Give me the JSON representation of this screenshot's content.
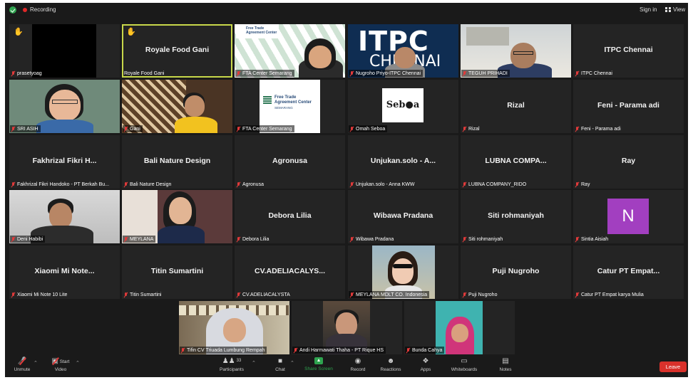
{
  "topbar": {
    "recording_label": "Recording",
    "signin_label": "Sign in",
    "view_label": "View"
  },
  "tiles": [
    {
      "name": "prasetyoag",
      "label": "prasetyoag",
      "center": "",
      "hand": true,
      "type": "black"
    },
    {
      "name": "Royale Food Gani",
      "label": "Royale Food Gani",
      "center": "Royale Food Gani",
      "hand": true,
      "type": "name-active"
    },
    {
      "name": "FTA Center Semarang 1",
      "label": "FTA Center Semarang",
      "center": "",
      "type": "fta-woman"
    },
    {
      "name": "Nugroho Priyo-ITPC Chennai",
      "label": "Nugroho Priyo-ITPC Chennai",
      "center": "",
      "type": "itpc"
    },
    {
      "name": "TEGUH PRIHADI",
      "label": "TEGUH PRIHADI",
      "center": "",
      "type": "man-glasses"
    },
    {
      "name": "ITPC Chennai",
      "label": "ITPC Chennai",
      "center": "ITPC Chennai",
      "type": "name"
    },
    {
      "name": "SRI ASIH",
      "label": "SRI ASIH",
      "center": "",
      "type": "woman-glasses"
    },
    {
      "name": "Gani",
      "label": "Gani",
      "center": "",
      "type": "gani"
    },
    {
      "name": "FTA Center Semarang 2",
      "label": "FTA Center Semarang",
      "center": "",
      "type": "fta-logo"
    },
    {
      "name": "Omah Seboa",
      "label": "Omah Seboa",
      "center": "",
      "type": "seboa"
    },
    {
      "name": "Rizal",
      "label": "Rizal",
      "center": "Rizal",
      "type": "name"
    },
    {
      "name": "Feni - Parama adi",
      "label": "Feni - Parama adi",
      "center": "Feni - Parama adi",
      "type": "name"
    },
    {
      "name": "Fakhrizal",
      "label": "Fakhrizal Fikri Handoko - PT Berkah Bu...",
      "center": "Fakhrizal Fikri H...",
      "type": "name"
    },
    {
      "name": "Bali Nature Design",
      "label": "Bali Nature Design",
      "center": "Bali Nature Design",
      "type": "name"
    },
    {
      "name": "Agronusa",
      "label": "Agronusa",
      "center": "Agronusa",
      "type": "name"
    },
    {
      "name": "Unjukan.solo",
      "label": "Unjukan.solo - Anna KWW",
      "center": "Unjukan.solo - A...",
      "type": "name"
    },
    {
      "name": "LUBNA COMPANY",
      "label": "LUBNA COMPANY_RIDO",
      "center": "LUBNA COMPA...",
      "type": "name"
    },
    {
      "name": "Ray",
      "label": "Ray",
      "center": "Ray",
      "type": "name"
    },
    {
      "name": "Deni Habibi",
      "label": "Deni Habibi",
      "center": "",
      "type": "deni"
    },
    {
      "name": "MEYLANA",
      "label": "MEYLANA",
      "center": "",
      "type": "meylana"
    },
    {
      "name": "Debora Lilia",
      "label": "Debora Lilia",
      "center": "Debora Lilia",
      "type": "name"
    },
    {
      "name": "Wibawa Pradana",
      "label": "Wibawa Pradana",
      "center": "Wibawa Pradana",
      "type": "name"
    },
    {
      "name": "Siti rohmaniyah",
      "label": "Siti rohmaniyah",
      "center": "Siti rohmaniyah",
      "type": "name"
    },
    {
      "name": "Sintia Aisiah",
      "label": "Sintia Aisiah",
      "center": "",
      "avatar": "N",
      "type": "avatar"
    },
    {
      "name": "Xiaomi Mi Note 10 Lite",
      "label": "Xiaomi Mi Note 10 Lite",
      "center": "Xiaomi Mi Note...",
      "type": "name"
    },
    {
      "name": "Titin Sumartini",
      "label": "Titin Sumartini",
      "center": "Titin Sumartini",
      "type": "name"
    },
    {
      "name": "CV.ADELIACALYSTA",
      "label": "CV.ADELIACALYSTA",
      "center": "CV.ADELIACALYS...",
      "type": "name"
    },
    {
      "name": "MEYLANA MDLT",
      "label": "MEYLANA MDLT CO. Indonesia",
      "center": "",
      "type": "selfie"
    },
    {
      "name": "Puji Nugroho",
      "label": "Puji Nugroho",
      "center": "Puji Nugroho",
      "type": "name"
    },
    {
      "name": "Catur PT Empat",
      "label": "Catur PT Empat karya Mulia",
      "center": "Catur PT Empat...",
      "type": "name"
    },
    {
      "name": "Tifin CV Triuada",
      "label": "Tifin CV Triuada Lumbung Rempah",
      "center": "",
      "type": "hijab-woman"
    },
    {
      "name": "Andi Harmawati",
      "label": "Andi Harmawati Thaha - PT Rique HS",
      "center": "",
      "type": "andi"
    },
    {
      "name": "Bunda Cahya",
      "label": "Bunda Cahya",
      "center": "",
      "type": "bunda"
    }
  ],
  "toolbar": {
    "unmute": "Unmute",
    "start_video": "Start Video",
    "participants": "Participants",
    "participants_count": "33",
    "chat": "Chat",
    "share_screen": "Share Screen",
    "record": "Record",
    "reactions": "Reactions",
    "apps": "Apps",
    "whiteboards": "Whiteboards",
    "notes": "Notes",
    "leave": "Leave"
  },
  "colors": {
    "background": "#1a1a1a",
    "tile": "#242424",
    "active_border": "#c8d84a",
    "share_green": "#2ea44f",
    "leave_red": "#d9312b",
    "avatar_purple": "#a23fc0"
  }
}
